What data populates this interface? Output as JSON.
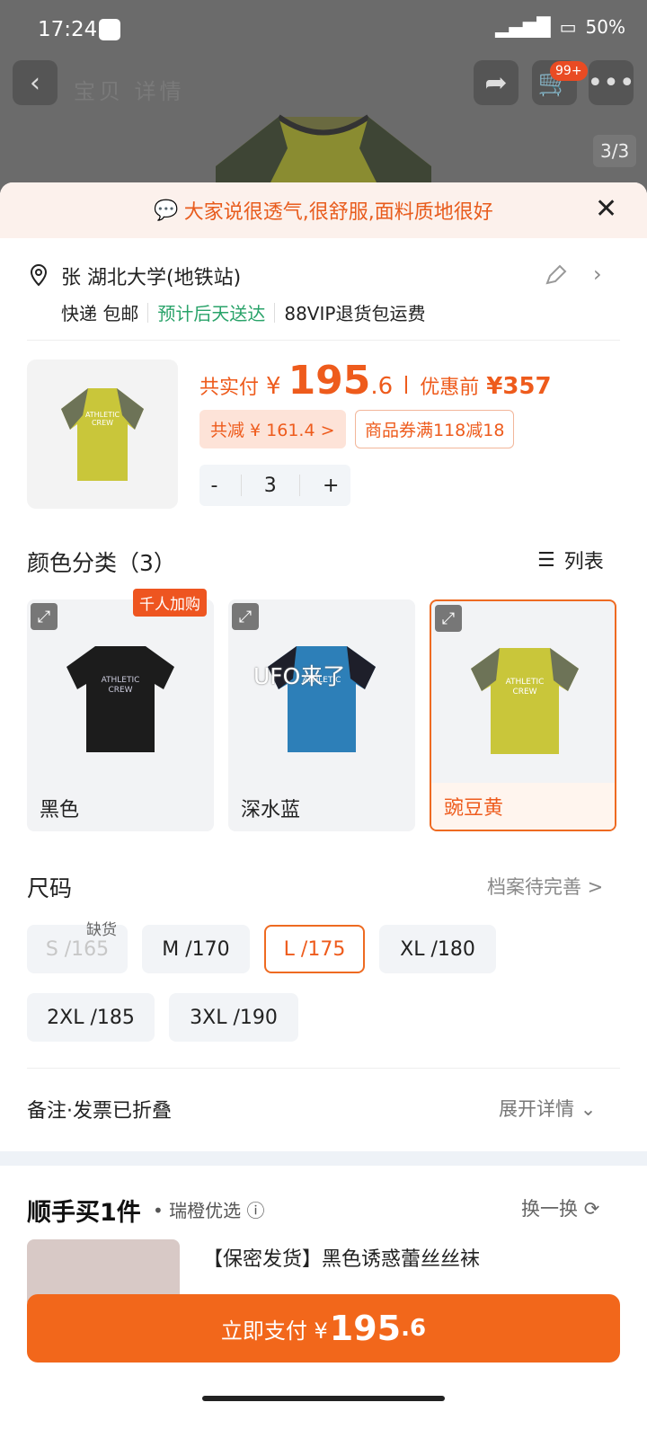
{
  "status_bar": {
    "time": "17:24",
    "battery": "50%"
  },
  "nav": {
    "title": "宝贝 详情",
    "cart_badge": "99+",
    "pager": "3/3"
  },
  "banner": {
    "text": "大家说很透气,很舒服,面料质地很好"
  },
  "address": {
    "name_line": "张 湖北大学(地铁站)",
    "shipping": "快递 包邮",
    "eta": "预计后天送达",
    "vip": "88VIP退货包运费"
  },
  "price": {
    "label": "共实付",
    "symbol": "¥",
    "int": "195",
    "dec": ".6",
    "before_label": "优惠前",
    "before_price": "¥357",
    "save_tag": "共减 ¥ 161.4 >",
    "coupon_tag": "商品券满118减18"
  },
  "qty": {
    "minus": "-",
    "value": "3",
    "plus": "+"
  },
  "color": {
    "title": "颜色分类（3）",
    "list_label": "列表",
    "hot_tag": "千人加购",
    "overlay": "UFO来了",
    "options": [
      "黑色",
      "深水蓝",
      "豌豆黄"
    ],
    "shirt_text_1": "ATHLETIC",
    "shirt_text_2": "CREW"
  },
  "size": {
    "title": "尺码",
    "profile": "档案待完善 >",
    "oos": "缺货",
    "options": [
      "S /165",
      "M /170",
      "L /175",
      "XL /180",
      "2XL /185",
      "3XL /190"
    ]
  },
  "notes": {
    "title": "备注·发票已折叠",
    "expand": "展开详情"
  },
  "shunshou": {
    "title": "顺手买1件",
    "sub": "• 瑞橙优选",
    "swap": "换一换",
    "item_title": "【保密发货】黑色诱惑蕾丝丝袜"
  },
  "pay": {
    "label": "立即支付 ¥",
    "amount": "195",
    "amount_dec": ".6"
  },
  "colors": {
    "accent": "#ee5b1c",
    "button": "#f2671b",
    "green": "#2aa36a"
  }
}
